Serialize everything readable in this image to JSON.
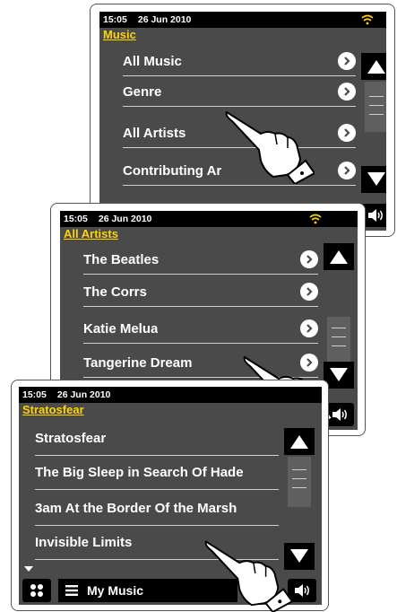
{
  "screens": [
    {
      "status": {
        "time": "15:05",
        "date": "26 Jun 2010"
      },
      "title": "Music",
      "items": [
        {
          "label": "All Music"
        },
        {
          "label": "Genre"
        },
        {
          "label": "All Artists"
        },
        {
          "label": "Contributing Ar"
        }
      ]
    },
    {
      "status": {
        "time": "15:05",
        "date": "26 Jun 2010"
      },
      "title": "All Artists",
      "items": [
        {
          "label": "The Beatles"
        },
        {
          "label": "The Corrs"
        },
        {
          "label": "Katie Melua"
        },
        {
          "label": "Tangerine Dream"
        }
      ]
    },
    {
      "status": {
        "time": "15:05",
        "date": "26 Jun 2010"
      },
      "title": "Stratosfear",
      "items": [
        {
          "label": "Stratosfear"
        },
        {
          "label": "The Big Sleep in Search Of Hade"
        },
        {
          "label": "3am At the Border Of the Marsh"
        },
        {
          "label": "Invisible Limits"
        }
      ],
      "bottom_menu": {
        "label": "My Music"
      }
    }
  ],
  "colors": {
    "title_yellow": "#ffd400",
    "screen_bg": "#4a4a4a",
    "bar_black": "#000000",
    "wifi_yellow": "#ffd400"
  },
  "icons": {
    "select": "chevron-right-icon",
    "scroll_up": "triangle-up-icon",
    "scroll_down": "triangle-down-icon",
    "volume": "speaker-icon",
    "home": "four-dots-icon",
    "menu": "hamburger-icon",
    "pointer": "pointing-hand-icon",
    "wifi": "wifi-icon"
  }
}
